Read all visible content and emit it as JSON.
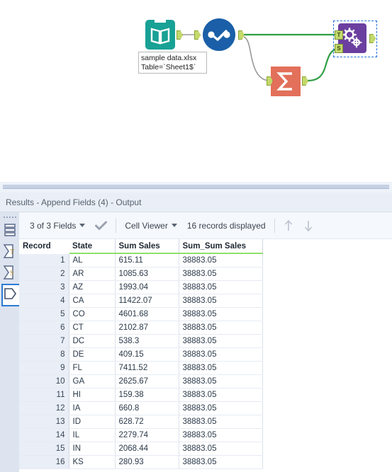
{
  "canvas": {
    "tools": [
      {
        "name": "input-data",
        "icon": "open-book-icon",
        "color": "#18a195"
      },
      {
        "name": "select",
        "icon": "select-checkmark-icon",
        "color": "#1a5fa8"
      },
      {
        "name": "summarize",
        "icon": "sigma-icon",
        "color": "#e2705a"
      },
      {
        "name": "append-fields",
        "icon": "gears-icon",
        "color": "#6b3fa0",
        "selected": true
      }
    ],
    "annotation": {
      "line1": "sample data.xlsx",
      "line2": "Table=`Sheet1$`"
    },
    "anchors": {
      "t_label": "T",
      "s_label": "S"
    },
    "connection_color": "#2f9e44",
    "connection_color_secondary": "#8a8a8a"
  },
  "results": {
    "title": "Results - Append Fields (4) - Output",
    "toolbar": {
      "fields_label": "3 of 3 Fields",
      "checkmark_icon": "checkmark-icon",
      "viewer_label": "Cell Viewer",
      "records_label": "16 records displayed",
      "up_arrow_icon": "arrow-up-icon",
      "down_arrow_icon": "arrow-down-icon"
    },
    "rail": [
      {
        "name": "table-view-icon",
        "selected": false
      },
      {
        "name": "sigma-t-icon",
        "selected": false
      },
      {
        "name": "sigma-s-icon",
        "selected": false
      },
      {
        "name": "data-polygon-icon",
        "selected": true
      }
    ],
    "table": {
      "headers": [
        "Record",
        "State",
        "Sum Sales",
        "Sum_Sum Sales"
      ],
      "rows": [
        [
          "1",
          "AL",
          "615.11",
          "38883.05"
        ],
        [
          "2",
          "AR",
          "1085.63",
          "38883.05"
        ],
        [
          "3",
          "AZ",
          "1993.04",
          "38883.05"
        ],
        [
          "4",
          "CA",
          "11422.07",
          "38883.05"
        ],
        [
          "5",
          "CO",
          "4601.68",
          "38883.05"
        ],
        [
          "6",
          "CT",
          "2102.87",
          "38883.05"
        ],
        [
          "7",
          "DC",
          "538.3",
          "38883.05"
        ],
        [
          "8",
          "DE",
          "409.15",
          "38883.05"
        ],
        [
          "9",
          "FL",
          "7411.52",
          "38883.05"
        ],
        [
          "10",
          "GA",
          "2625.67",
          "38883.05"
        ],
        [
          "11",
          "HI",
          "159.38",
          "38883.05"
        ],
        [
          "12",
          "IA",
          "660.8",
          "38883.05"
        ],
        [
          "13",
          "ID",
          "628.72",
          "38883.05"
        ],
        [
          "14",
          "IL",
          "2279.74",
          "38883.05"
        ],
        [
          "15",
          "IN",
          "2068.44",
          "38883.05"
        ],
        [
          "16",
          "KS",
          "280.93",
          "38883.05"
        ]
      ]
    }
  }
}
